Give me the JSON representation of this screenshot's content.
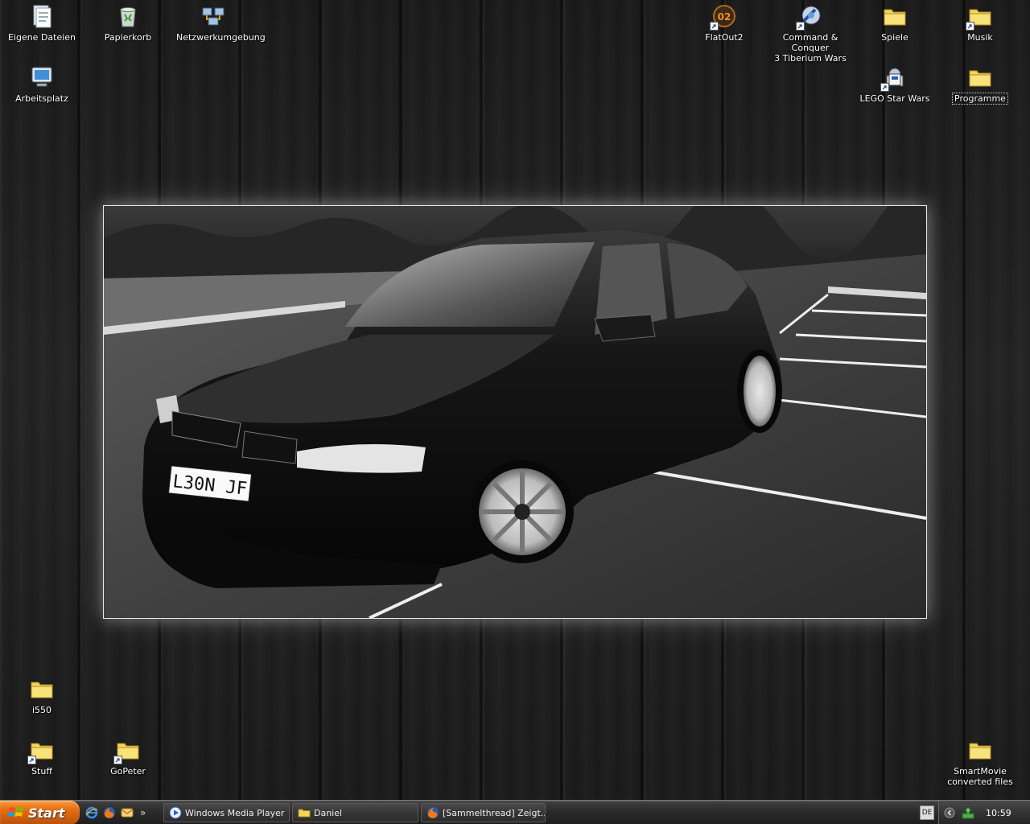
{
  "desktop": {
    "icons": [
      {
        "id": "eigene-dateien",
        "label": "Eigene Dateien",
        "icon": "documents-icon"
      },
      {
        "id": "papierkorb",
        "label": "Papierkorb",
        "icon": "recycle-bin-icon"
      },
      {
        "id": "netzwerkumgebung",
        "label": "Netzwerkumgebung",
        "icon": "network-icon"
      },
      {
        "id": "arbeitsplatz",
        "label": "Arbeitsplatz",
        "icon": "computer-icon"
      },
      {
        "id": "flatout2",
        "label": "FlatOut2",
        "icon": "flatout-game-icon"
      },
      {
        "id": "cnc3",
        "label_line1": "Command & Conquer",
        "label_line2": "3 Tiberium Wars",
        "icon": "cnc-game-icon"
      },
      {
        "id": "spiele",
        "label": "Spiele",
        "icon": "folder-icon"
      },
      {
        "id": "musik",
        "label": "Musik",
        "icon": "folder-icon"
      },
      {
        "id": "lego-star-wars",
        "label": "LEGO Star Wars",
        "icon": "r2d2-game-icon"
      },
      {
        "id": "programme",
        "label": "Programme",
        "icon": "folder-icon"
      },
      {
        "id": "i550",
        "label": "i550",
        "icon": "folder-icon"
      },
      {
        "id": "stuff",
        "label": "Stuff",
        "icon": "folder-icon"
      },
      {
        "id": "gopeter",
        "label": "GoPeter",
        "icon": "folder-icon"
      },
      {
        "id": "smartmovie",
        "label_line1": "SmartMovie",
        "label_line2": "converted files",
        "icon": "folder-icon"
      }
    ]
  },
  "wallpaper": {
    "plate": "L30N JF"
  },
  "taskbar": {
    "start_label": "Start",
    "quicklaunch": [
      "ie-icon",
      "firefox-icon",
      "thunderbird-icon"
    ],
    "more": "»",
    "tasks": [
      {
        "label": "Windows Media Player",
        "icon": "media-player-icon"
      },
      {
        "label": "Daniel",
        "icon": "folder-icon"
      },
      {
        "label": "[Sammelthread] Zeigt...",
        "icon": "firefox-icon"
      }
    ],
    "language": "DE",
    "clock": "10:59"
  },
  "colors": {
    "folder": "#f3d55b",
    "start": "#e36b12",
    "taskbar": "#2a2a2a"
  }
}
